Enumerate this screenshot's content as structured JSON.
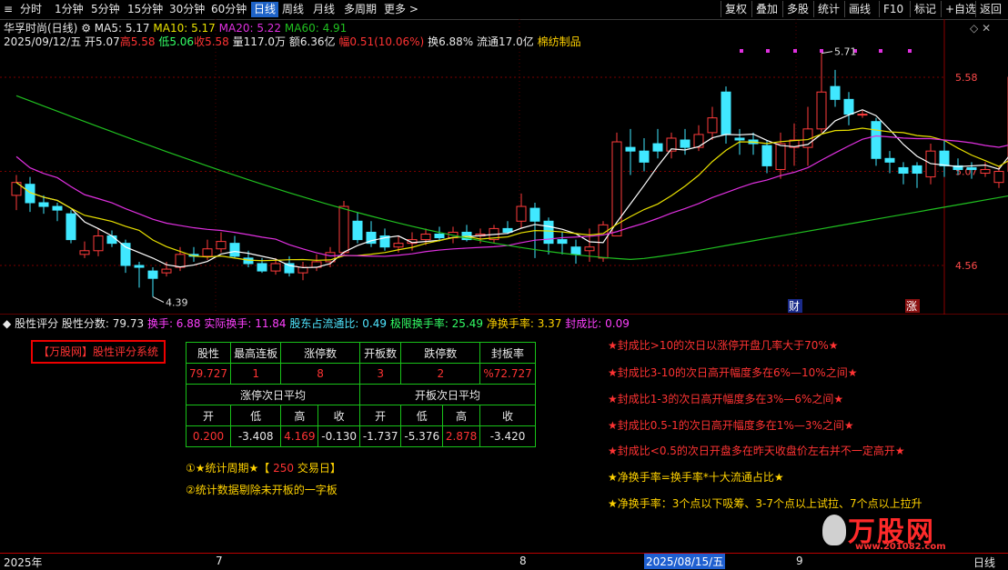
{
  "toolbar": {
    "tabs": [
      "分时",
      "1分钟",
      "5分钟",
      "15分钟",
      "30分钟",
      "60分钟",
      "日线",
      "周线",
      "月线",
      "多周期",
      "更多 >"
    ],
    "active_tab": "日线",
    "right_buttons": [
      "复权",
      "叠加",
      "多股",
      "统计",
      "画线",
      "F10",
      "标记",
      "+自选",
      "返回"
    ]
  },
  "header": {
    "stock_title": "华孚时尚(日线)",
    "ma5": "MA5: 5.17",
    "ma10": "MA10: 5.17",
    "ma20": "MA20: 5.22",
    "ma60": "MA60: 4.91",
    "date": "2025/09/12/五",
    "open": "开5.07",
    "high": "高5.58",
    "low": "低5.06",
    "close": "收5.58",
    "volume": "量117.0万",
    "amount": "额6.36亿",
    "amplitude": "幅0.51(10.06%)",
    "turnover": "换6.88%",
    "float_cap": "流通17.0亿",
    "industry": "棉纺制品"
  },
  "chart": {
    "price_labels": [
      "5.58",
      "5.07",
      "4.56"
    ],
    "max_label": "5.71",
    "min_label": "4.39",
    "marker_cai": "财",
    "marker_zhang": "涨",
    "colors": {
      "up": "#ff3b3b",
      "down": "#40e8ff",
      "ma5": "#ffffff",
      "ma10": "#e8e000",
      "ma20": "#e030e0",
      "ma60": "#20c020",
      "grid": "#7a0000"
    }
  },
  "indicator": {
    "name": "股性评分",
    "score": "股性分数: 79.73",
    "turnover": "换手: 6.88",
    "real_turnover": "实际换手: 11.84",
    "holder_ratio": "股东占流通比: 0.49",
    "limit_turnover": "极限换手率: 25.49",
    "net_turnover": "净换手率: 3.37",
    "seal_ratio": "封成比: 0.09"
  },
  "panel": {
    "logo_text": "【万股网】股性评分系统",
    "table": {
      "headers": [
        "股性",
        "最高连板",
        "涨停数",
        "开板数",
        "跌停数",
        "封板率"
      ],
      "values": [
        "79.727",
        "1",
        "8",
        "3",
        "2",
        "%72.727"
      ],
      "group_a": "涨停次日平均",
      "group_b": "开板次日平均",
      "sub_headers": [
        "开",
        "低",
        "高",
        "收",
        "开",
        "低",
        "高",
        "收"
      ],
      "sub_values": [
        "0.200",
        "-3.408",
        "4.169",
        "-0.130",
        "-1.737",
        "-5.376",
        "2.878",
        "-3.420"
      ]
    },
    "note1_prefix": "①★统计周期★【",
    "note1_value": "250",
    "note1_suffix": "交易日】",
    "note2": "②统计数据剔除未开板的一字板",
    "rules": [
      "★封成比>10的次日以涨停开盘几率大于70%★",
      "★封成比3-10的次日高开幅度多在6%—10%之间★",
      "★封成比1-3的次日高开幅度多在3%—6%之间★",
      "★封成比0.5-1的次日高开幅度多在1%—3%之间★",
      "★封成比<0.5的次日开盘多在昨天收盘价左右并不一定高开★"
    ],
    "formula1": "★净换手率=换手率*十大流通占比★",
    "formula2": "★净换手率：3个点以下吸筹、3-7个点以上试拉、7个点以上拉升",
    "watermark_brand": "万股网",
    "watermark_url": "www.201082.com"
  },
  "timebar": {
    "labels": [
      "2025年",
      "7",
      "8",
      "2025/08/15/五",
      "9"
    ],
    "period": "日线"
  }
}
